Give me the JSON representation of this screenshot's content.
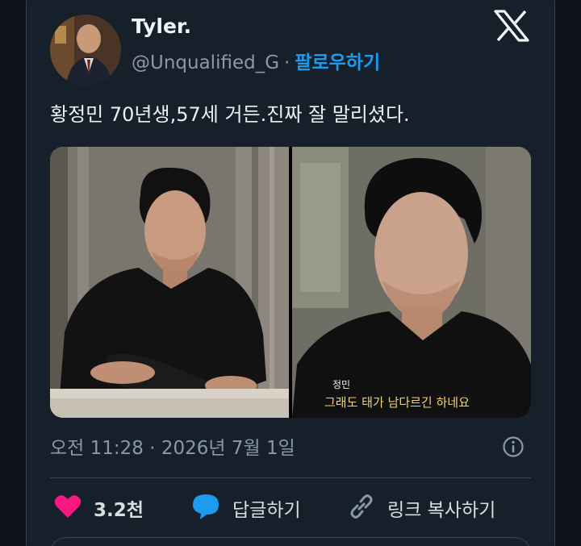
{
  "tweet": {
    "author_name": "Tyler.",
    "handle": "@Unqualified_G",
    "separator": "·",
    "follow_label": "팔로우하기",
    "text": "황정민 70년생,57세 거든.진짜 잘 말리셨다.",
    "subtitle_speaker": "정민",
    "subtitle_text": "그래도 태가 남다르긴 하네요",
    "timestamp": "오전 11:28 · 2026년 7월 1일"
  },
  "actions": {
    "like_count": "3.2천",
    "reply_label": "답글하기",
    "copy_link_label": "링크 복사하기"
  },
  "colors": {
    "background": "#15202b",
    "accent": "#1d9bf0",
    "like": "#f91880",
    "muted_text": "#8b98a5"
  },
  "icons": [
    "x-logo-icon",
    "info-icon",
    "heart-icon",
    "reply-bubble-icon",
    "link-icon"
  ]
}
